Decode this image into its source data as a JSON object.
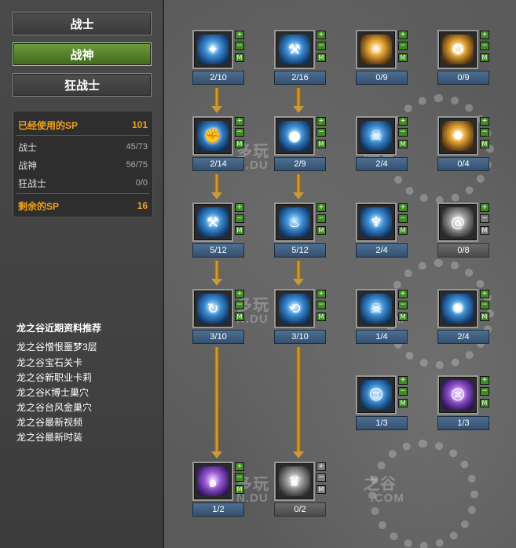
{
  "class_tabs": [
    {
      "label": "战士",
      "active": false
    },
    {
      "label": "战神",
      "active": true
    },
    {
      "label": "狂战士",
      "active": false
    }
  ],
  "sp_summary": {
    "used_label": "已经使用的SP",
    "used_value": "101",
    "rows": [
      {
        "label": "战士",
        "value": "45/73"
      },
      {
        "label": "战神",
        "value": "56/75"
      },
      {
        "label": "狂战士",
        "value": "0/0"
      }
    ],
    "remaining_label": "剩余的SP",
    "remaining_value": "16",
    "highlight_color": "#f0a020"
  },
  "recommend": {
    "title": "龙之谷近期资料推荐",
    "links": [
      "龙之谷憎恨噩梦3层",
      "龙之谷宝石关卡",
      "龙之谷新职业卡莉",
      "龙之谷K博士巢穴",
      "龙之谷台风金巢穴",
      "龙之谷最新视频",
      "龙之谷最新时装"
    ]
  },
  "tree": {
    "watermark_text": [
      "多玩",
      "之谷",
      "N.DU",
      ".COM"
    ],
    "buttons": {
      "plus": "+",
      "minus": "−",
      "max": "M"
    },
    "skills": [
      {
        "level": "2/10",
        "icon": "spike-burst-icon",
        "style": "blue"
      },
      {
        "level": "2/16",
        "icon": "axe-swing-icon",
        "style": "blue"
      },
      {
        "level": "0/9",
        "icon": "face-aura-icon",
        "style": "gold"
      },
      {
        "level": "0/9",
        "icon": "flame-axe-icon",
        "style": "gold"
      },
      {
        "level": "2/14",
        "icon": "fist-strike-icon",
        "style": "blue"
      },
      {
        "level": "2/9",
        "icon": "bomb-orb-icon",
        "style": "blue"
      },
      {
        "level": "2/4",
        "icon": "demon-face-icon",
        "style": "blue"
      },
      {
        "level": "0/4",
        "icon": "fire-orb-icon",
        "style": "gold"
      },
      {
        "level": "5/12",
        "icon": "hammer-icon",
        "style": "blue"
      },
      {
        "level": "5/12",
        "icon": "flame-pillar-icon",
        "style": "blue"
      },
      {
        "level": "2/4",
        "icon": "guardian-icon",
        "style": "blue"
      },
      {
        "level": "0/8",
        "icon": "spiral-icon",
        "style": "grey",
        "disabled": true
      },
      {
        "level": "3/10",
        "icon": "whirlwind-icon",
        "style": "blue"
      },
      {
        "level": "3/10",
        "icon": "swing-arc-icon",
        "style": "blue"
      },
      {
        "level": "1/4",
        "icon": "skull-icon",
        "style": "blue"
      },
      {
        "level": "2/4",
        "icon": "spirit-burst-icon",
        "style": "blue"
      },
      {
        "level": "1/3",
        "icon": "mask-icon",
        "style": "blue"
      },
      {
        "level": "1/3",
        "icon": "rage-face-icon",
        "style": "purple"
      },
      {
        "level": "1/2",
        "icon": "vortex-icon",
        "style": "purple"
      },
      {
        "level": "0/2",
        "icon": "crown-spike-icon",
        "style": "grey",
        "locked": true
      }
    ]
  }
}
